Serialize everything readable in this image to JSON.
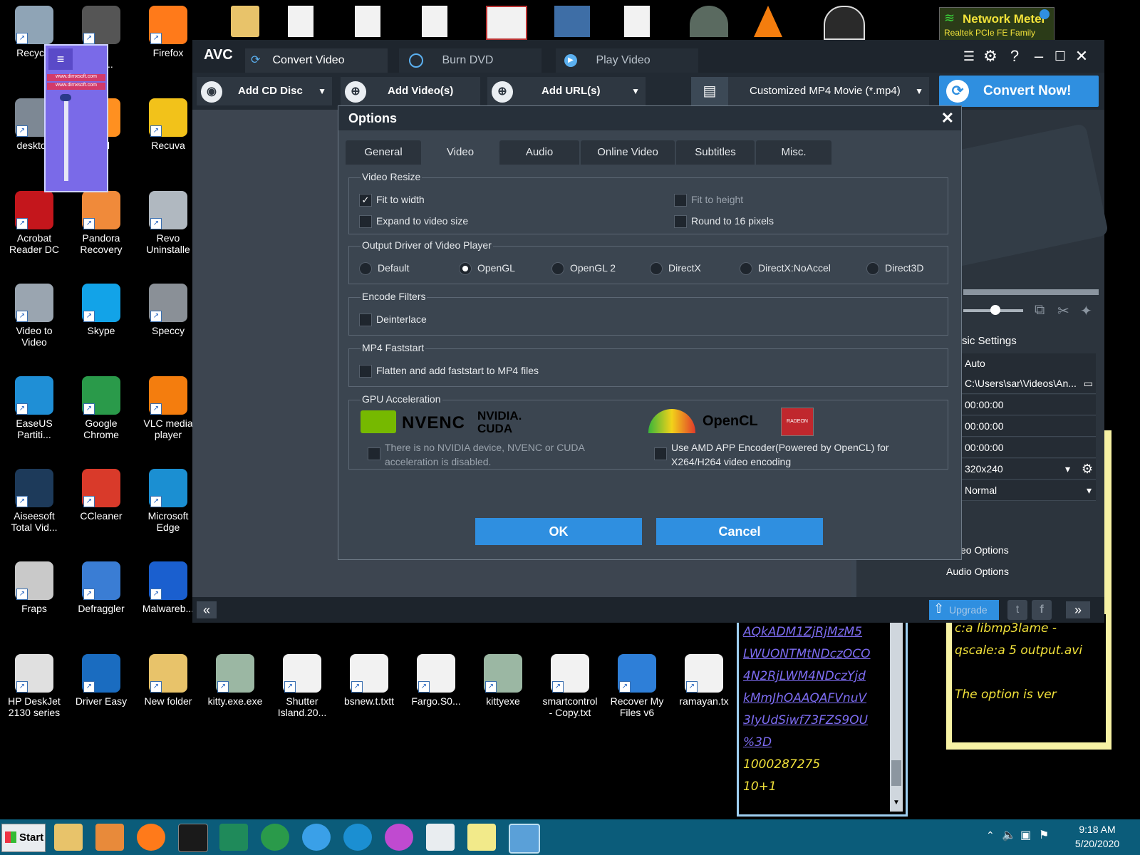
{
  "desktop": {
    "icons": [
      {
        "label": "Recycle",
        "color": "#8fa4b6"
      },
      {
        "label": "for\nles ...",
        "color": "#555"
      },
      {
        "label": "Firefox",
        "color": "#ff7a1a"
      },
      {
        "label": "desktop",
        "color": "#7d8894"
      },
      {
        "label": "Drill",
        "color": "#ff9020"
      },
      {
        "label": "Recuva",
        "color": "#f2c21a"
      },
      {
        "label": "Acrobat\nReader DC",
        "color": "#c4161c"
      },
      {
        "label": "Pandora\nRecovery",
        "color": "#f08a3a"
      },
      {
        "label": "Revo\nUninstalle",
        "color": "#b0b8c0"
      },
      {
        "label": "Video to\nVideo",
        "color": "#9aa5b0"
      },
      {
        "label": "Skype",
        "color": "#12a3e8"
      },
      {
        "label": "Speccy",
        "color": "#8a9097"
      },
      {
        "label": "EaseUS\nPartiti...",
        "color": "#1f8fd6"
      },
      {
        "label": "Google\nChrome",
        "color": "#2a9a4a"
      },
      {
        "label": "VLC media\nplayer",
        "color": "#f47d0e"
      },
      {
        "label": "Aiseesoft\nTotal Vid...",
        "color": "#1d3a5a"
      },
      {
        "label": "CCleaner",
        "color": "#d93a2a"
      },
      {
        "label": "Microsoft\nEdge",
        "color": "#1b8fd2"
      },
      {
        "label": "Fraps",
        "color": "#c9c9c9"
      },
      {
        "label": "Defraggler",
        "color": "#3a7dd4"
      },
      {
        "label": "Malwareb...",
        "color": "#1a5fcf"
      },
      {
        "label": "HP DeskJet\n2130 series",
        "color": "#e0e0e0"
      },
      {
        "label": "Driver Easy",
        "color": "#1a6cc0"
      },
      {
        "label": "New folder",
        "color": "#e8c36a"
      },
      {
        "label": "kitty.exe.exe",
        "color": "#9bb7a3"
      },
      {
        "label": "Shutter\nIsland.20...",
        "color": "#f2f2f2"
      },
      {
        "label": "bsnew.t.txtt",
        "color": "#f2f2f2"
      },
      {
        "label": "Fargo.S0...",
        "color": "#f2f2f2"
      },
      {
        "label": "kittyexe",
        "color": "#9bb7a3"
      },
      {
        "label": "smartcontrol\n- Copy.txt",
        "color": "#f2f2f2"
      },
      {
        "label": "Recover My\nFiles v6",
        "color": "#2e7fd8"
      },
      {
        "label": "ramayan.tx",
        "color": "#f2f2f2"
      }
    ],
    "network_meter": {
      "title": "Network Meter",
      "subtitle": "Realtek PCIe FE Family"
    },
    "note_left": [
      "AQkADM1ZjRjMzM5",
      "LWUONTMtNDczOCO",
      "4N2RjLWM4NDczYjd",
      "kMmJhOAAQAFVnuV",
      "3IyUdSiwf73FZS9OU",
      "%3D",
      "1000287275",
      "10+1"
    ],
    "note_right": [
      "c:a libmp3lame -",
      "qscale:a 5 output.avi",
      "",
      "The option is ver"
    ],
    "mini_widget": {
      "line1": "www.dimxsoft.com",
      "line2": "www.dimxsoft.com"
    }
  },
  "app": {
    "logo": "AVC",
    "tabs": [
      "Convert Video",
      "Burn DVD",
      "Play Video"
    ],
    "window_controls": {
      "help": "?"
    },
    "toolbar": {
      "add_cd": "Add CD Disc",
      "add_videos": "Add Video(s)",
      "add_urls": "Add URL(s)",
      "format": "Customized MP4 Movie (*.mp4)",
      "convert": "Convert Now!"
    },
    "right_panel": {
      "basic_settings": "sic Settings",
      "rows": [
        "Auto",
        "C:\\Users\\sar\\Videos\\An...",
        "00:00:00",
        "00:00:00",
        "00:00:00",
        "320x240",
        "Normal"
      ],
      "video_options": "Video Options",
      "audio_options": "Audio Options"
    },
    "bottom": {
      "prev": "«",
      "next": "»",
      "upgrade": "Upgrade"
    }
  },
  "dialog": {
    "title": "Options",
    "tabs": [
      "General",
      "Video",
      "Audio",
      "Online Video",
      "Subtitles",
      "Misc."
    ],
    "active_tab": "Video",
    "video_resize": {
      "title": "Video Resize",
      "fit_width": "Fit to width",
      "fit_height": "Fit to height",
      "expand": "Expand to video size",
      "round16": "Round to 16 pixels"
    },
    "output_driver": {
      "title": "Output Driver of Video Player",
      "options": [
        "Default",
        "OpenGL",
        "OpenGL 2",
        "DirectX",
        "DirectX:NoAccel",
        "Direct3D"
      ],
      "selected": "OpenGL"
    },
    "encode_filters": {
      "title": "Encode Filters",
      "deinterlace": "Deinterlace"
    },
    "mp4_faststart": {
      "title": "MP4 Faststart",
      "flatten": "Flatten and add faststart to MP4 files"
    },
    "gpu": {
      "title": "GPU Acceleration",
      "nvenc": "NVENC",
      "cuda_line1": "NVIDIA.",
      "cuda_line2": "CUDA",
      "opencl": "OpenCL",
      "radeon": "RADEON",
      "nvidia_msg": "There is no NVIDIA device, NVENC or CUDA\nacceleration is disabled.",
      "amd_msg": "Use AMD APP Encoder(Powered by OpenCL) for\nX264/H264 video encoding"
    },
    "ok": "OK",
    "cancel": "Cancel"
  },
  "taskbar": {
    "start": "Start",
    "time": "9:18 AM",
    "date": "5/20/2020"
  }
}
